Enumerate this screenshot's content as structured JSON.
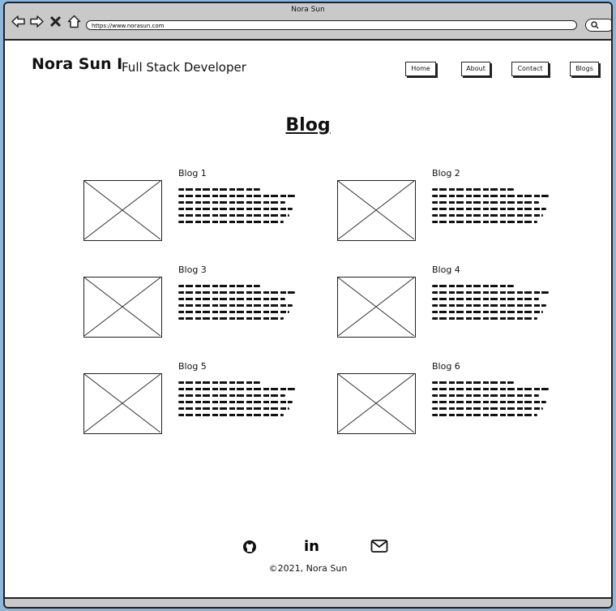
{
  "window": {
    "title": "Nora Sun"
  },
  "browser": {
    "url": "https://www.norasun.com"
  },
  "header": {
    "brand": "Nora Sun I",
    "tagline": "Full Stack Developer",
    "nav": [
      "Home",
      "About",
      "Contact",
      "Blogs"
    ]
  },
  "main": {
    "heading": "Blog",
    "posts": [
      {
        "title": "Blog 1"
      },
      {
        "title": "Blog 2"
      },
      {
        "title": "Blog 3"
      },
      {
        "title": "Blog 4"
      },
      {
        "title": "Blog 5"
      },
      {
        "title": "Blog 6"
      }
    ]
  },
  "footer": {
    "icons": [
      "github-icon",
      "linkedin-icon",
      "mail-icon"
    ],
    "linkedin_text": "in",
    "copyright": "©2021, Nora Sun"
  }
}
